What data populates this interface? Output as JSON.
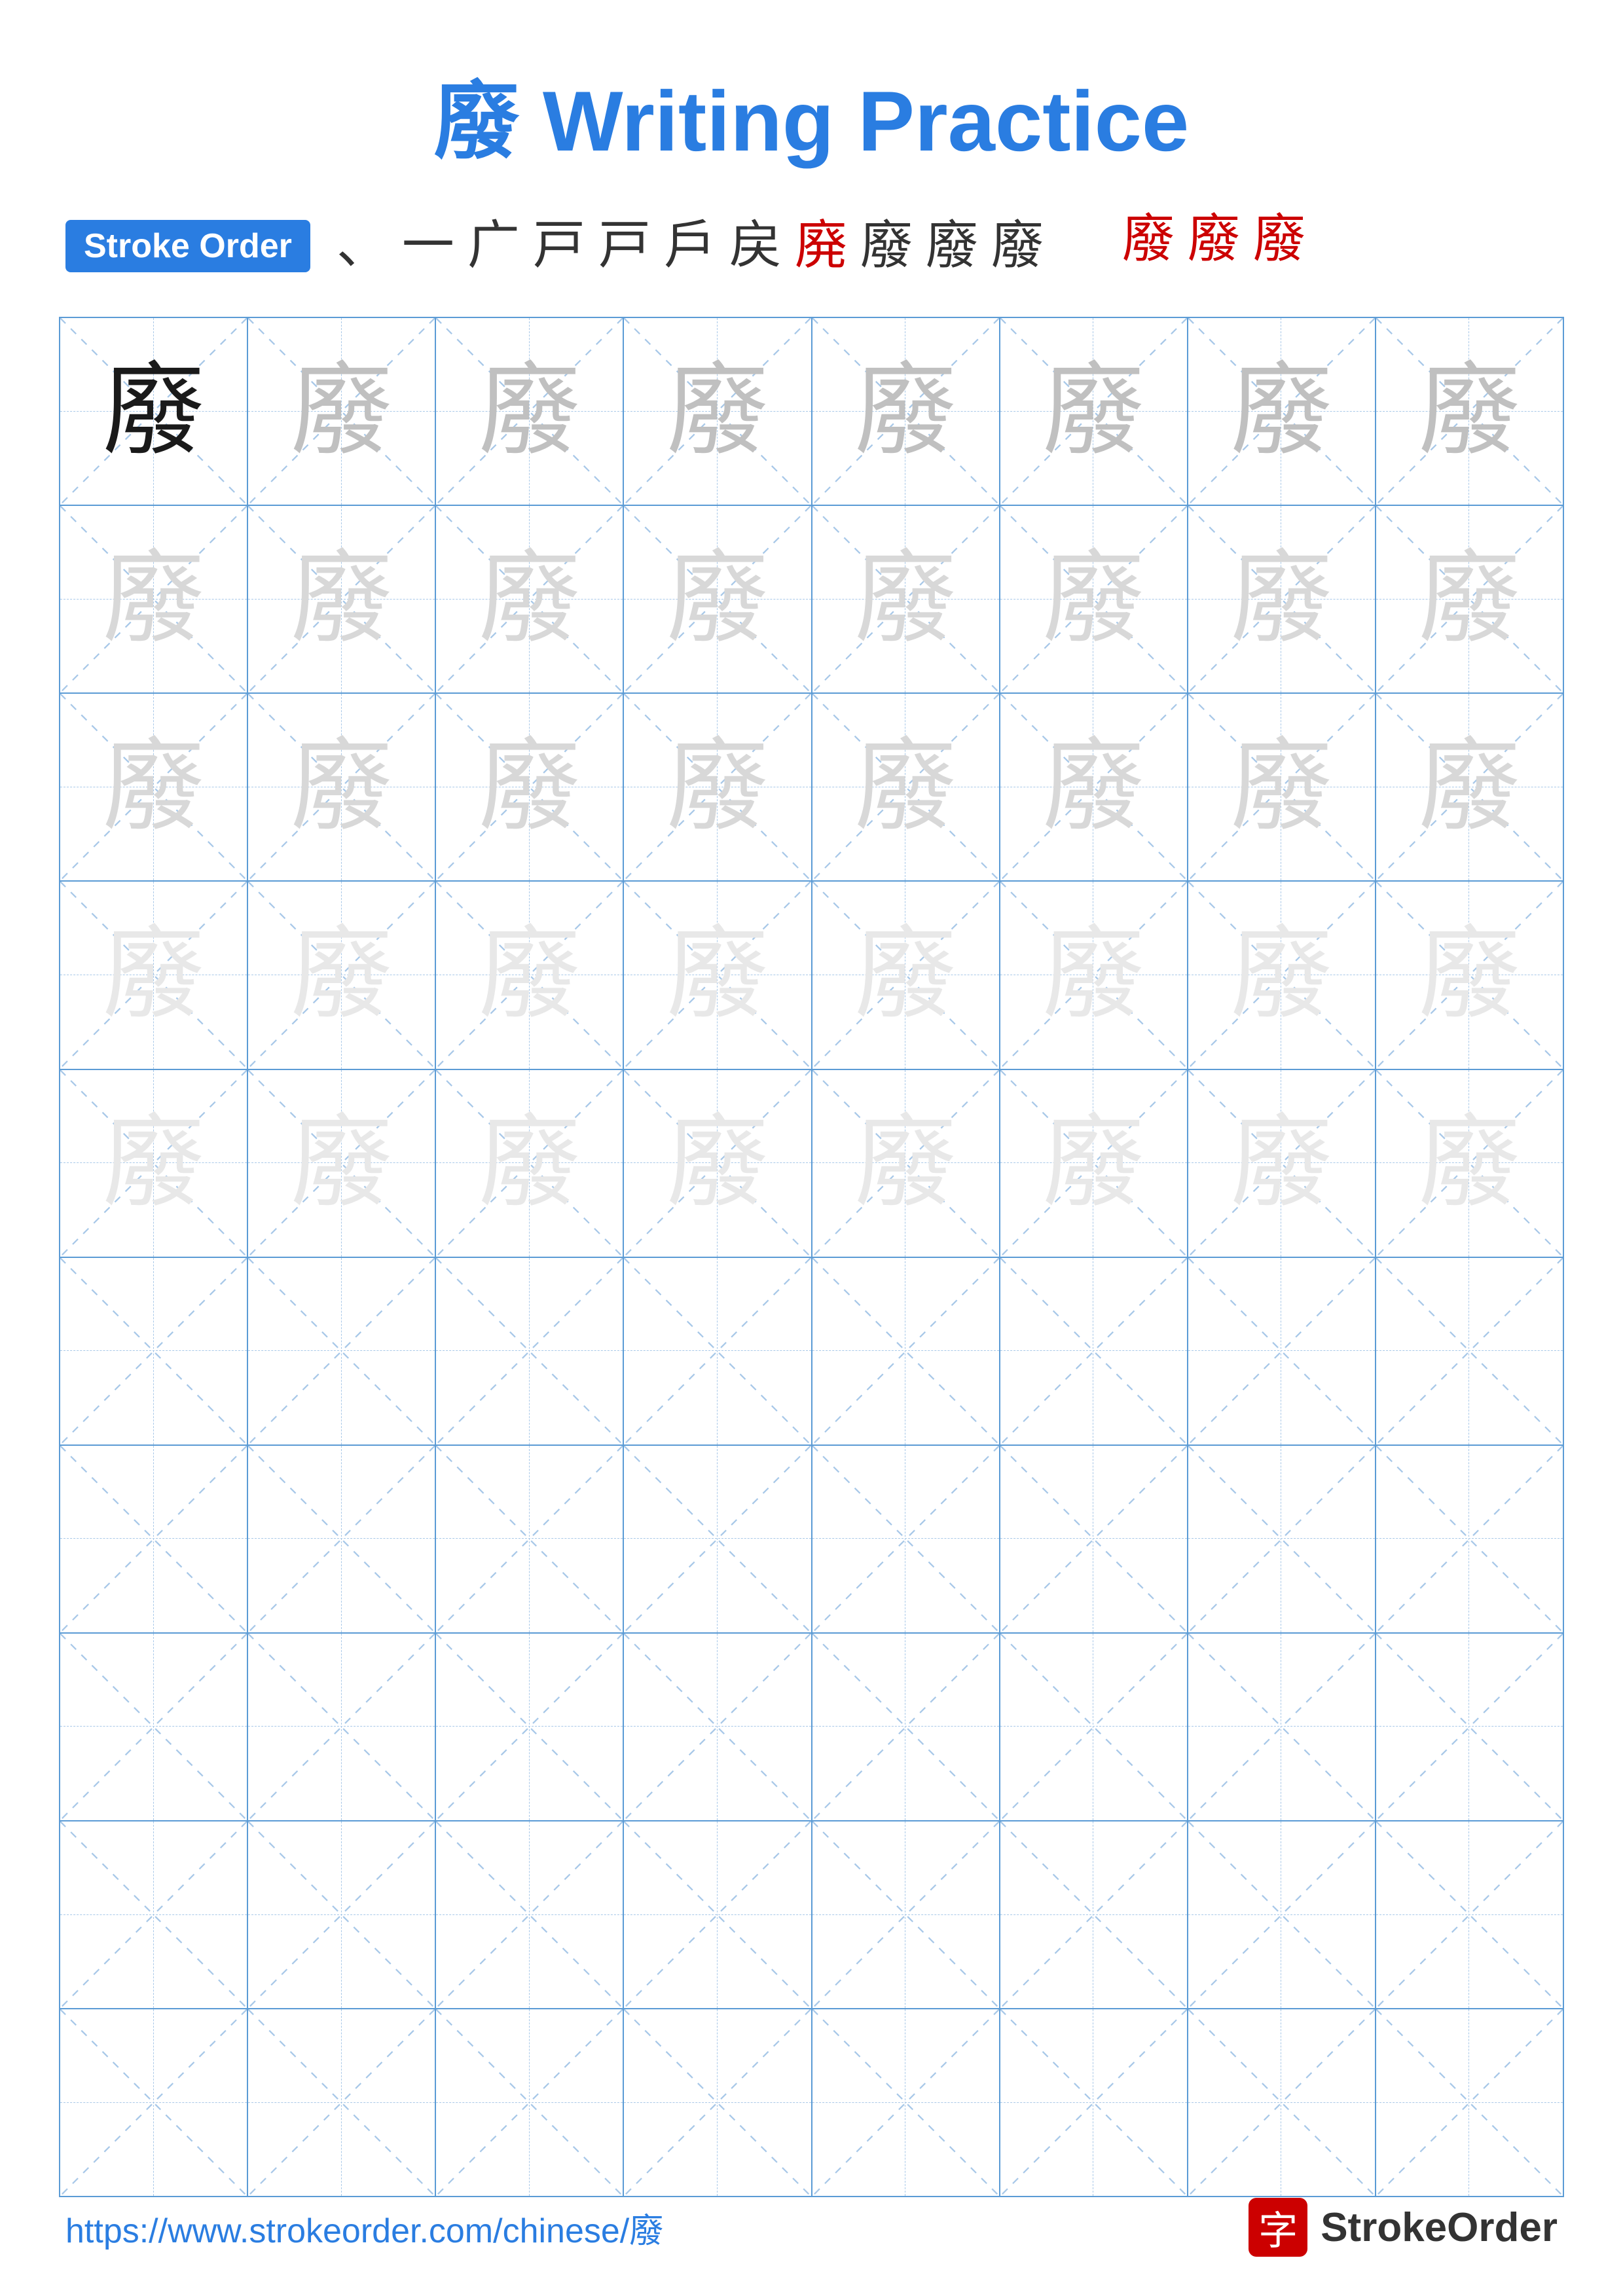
{
  "title": {
    "char": "廢",
    "text": " Writing Practice",
    "full": "廢 Writing Practice"
  },
  "stroke_order": {
    "badge_label": "Stroke Order",
    "strokes_row1": [
      "、",
      "一",
      "广",
      "戸",
      "戸",
      "戶",
      "戻",
      "廃",
      "廢",
      "廢",
      "廢"
    ],
    "strokes_row2": [
      "廢",
      "廢",
      "廢"
    ]
  },
  "practice_char": "廢",
  "grid": {
    "cols": 8,
    "rows_with_char": 5,
    "rows_empty": 5
  },
  "footer": {
    "url": "https://www.strokeorder.com/chinese/廢",
    "logo_char": "字",
    "logo_text": "StrokeOrder"
  },
  "colors": {
    "blue": "#2a7de1",
    "red": "#cc0000",
    "grid_line": "#5b9bd5",
    "grid_dash": "#a8c8e8"
  }
}
